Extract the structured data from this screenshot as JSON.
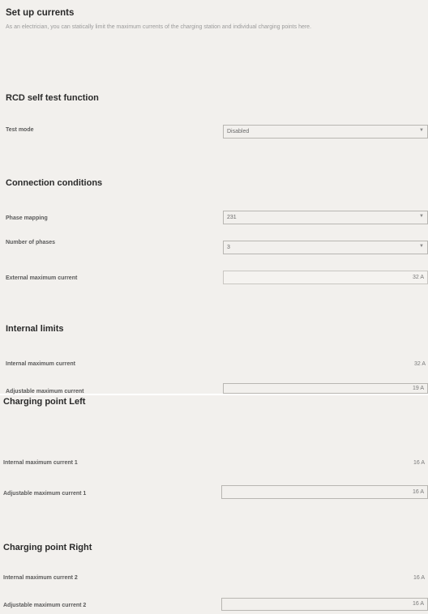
{
  "header": {
    "title": "Set up currents",
    "description": "As an electrician, you can statically limit the maximum currents of the charging station and individual charging points here."
  },
  "rcd": {
    "title": "RCD self test function",
    "test_mode_label": "Test mode",
    "test_mode_value": "Disabled"
  },
  "connection": {
    "title": "Connection conditions",
    "phase_mapping_label": "Phase mapping",
    "phase_mapping_value": "231",
    "phases_label": "Number of phases",
    "phases_value": "3",
    "external_max_label": "External maximum current",
    "external_max_value": "32 A"
  },
  "internal": {
    "title": "Internal limits",
    "internal_max_label": "Internal maximum current",
    "internal_max_value": "32 A",
    "adjustable_max_label": "Adjustable maximum current",
    "adjustable_max_value": "19 A"
  },
  "left": {
    "title": "Charging point Left",
    "internal_max_label": "Internal maximum current 1",
    "internal_max_value": "16 A",
    "adjustable_max_label": "Adjustable maximum current 1",
    "adjustable_max_value": "16 A"
  },
  "right": {
    "title": "Charging point Right",
    "internal_max_label": "Internal maximum current 2",
    "internal_max_value": "16 A",
    "adjustable_max_label": "Adjustable maximum current 2",
    "adjustable_max_value": "16 A"
  },
  "icons": {
    "dropdown": "chevron-down-icon"
  }
}
